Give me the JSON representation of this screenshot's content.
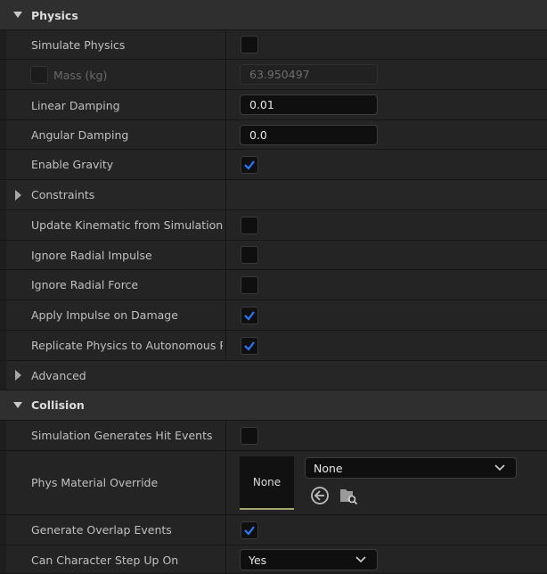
{
  "sections": {
    "physics": "Physics",
    "collision": "Collision"
  },
  "physics": {
    "simulate_physics": {
      "label": "Simulate Physics",
      "checked": false
    },
    "mass": {
      "label": "Mass (kg)",
      "value": "63.950497",
      "enabled": false,
      "override_checked": false
    },
    "linear_damping": {
      "label": "Linear Damping",
      "value": "0.01"
    },
    "angular_damping": {
      "label": "Angular Damping",
      "value": "0.0"
    },
    "enable_gravity": {
      "label": "Enable Gravity",
      "checked": true
    },
    "constraints": {
      "label": "Constraints"
    },
    "update_kinematic": {
      "label": "Update Kinematic from Simulation",
      "checked": false
    },
    "ignore_radial_impulse": {
      "label": "Ignore Radial Impulse",
      "checked": false
    },
    "ignore_radial_force": {
      "label": "Ignore Radial Force",
      "checked": false
    },
    "apply_impulse_on_damage": {
      "label": "Apply Impulse on Damage",
      "checked": true
    },
    "replicate_physics": {
      "label": "Replicate Physics to Autonomous Pr...",
      "checked": true
    },
    "advanced": {
      "label": "Advanced"
    }
  },
  "collision": {
    "sim_hit_events": {
      "label": "Simulation Generates Hit Events",
      "checked": false
    },
    "phys_material": {
      "label": "Phys Material Override",
      "thumbnail": "None",
      "selected": "None"
    },
    "overlap_events": {
      "label": "Generate Overlap Events",
      "checked": true
    },
    "step_up_on": {
      "label": "Can Character Step Up On",
      "selected": "Yes"
    }
  },
  "icons": {
    "section_arrow": "triangle-down-icon",
    "group_arrow": "triangle-right-icon",
    "check": "checkmark-icon",
    "dropdown": "chevron-down-icon",
    "use_selected": "arrow-left-circle-icon",
    "browse": "browse-folder-icon"
  },
  "colors": {
    "check": "#2a78ff",
    "panel": "#242424",
    "section": "#2f2f2f"
  }
}
